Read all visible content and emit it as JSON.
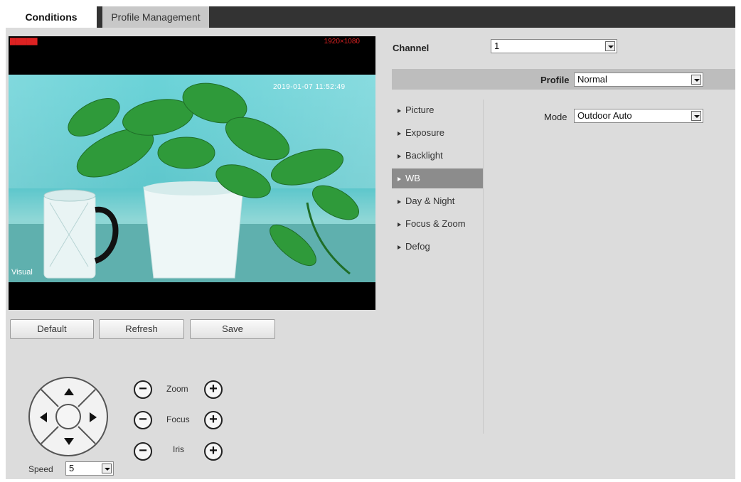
{
  "tabs": {
    "conditions": "Conditions",
    "profile_management": "Profile Management"
  },
  "video": {
    "top_right": "1920×1080",
    "timestamp": "2019-01-07 11:52:49",
    "bottom_label": "Visual"
  },
  "buttons": {
    "default": "Default",
    "refresh": "Refresh",
    "save": "Save"
  },
  "ptz": {
    "zoom": "Zoom",
    "focus": "Focus",
    "iris": "Iris",
    "speed_label": "Speed",
    "speed_value": "5",
    "minus": "−",
    "plus": "+"
  },
  "channel": {
    "label": "Channel",
    "value": "1"
  },
  "profile": {
    "label": "Profile",
    "value": "Normal"
  },
  "menu": {
    "items": [
      "Picture",
      "Exposure",
      "Backlight",
      "WB",
      "Day & Night",
      "Focus & Zoom",
      "Defog"
    ],
    "active": "WB"
  },
  "mode": {
    "label": "Mode",
    "value": "Outdoor Auto"
  },
  "colors": {
    "tab_bar": "#333333",
    "panel": "#dcdcdc",
    "active_menu": "#8c8c8c",
    "profile_bar": "#bdbdbd"
  }
}
